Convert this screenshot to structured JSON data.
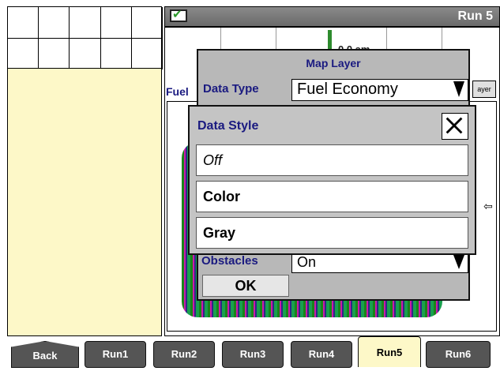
{
  "header": {
    "run_label": "Run 5"
  },
  "map": {
    "scale_label": "0.0 am",
    "field_label": "Fuel",
    "layer_button": "ayer"
  },
  "map_layer_dialog": {
    "title": "Map Layer",
    "data_type_label": "Data Type",
    "data_type_value": "Fuel Economy",
    "obstacles_label": "Obstacles",
    "obstacles_value": "On",
    "ok_label": "OK"
  },
  "data_style_popup": {
    "title": "Data Style",
    "options": [
      "Off",
      "Color",
      "Gray"
    ]
  },
  "tabs": [
    "Back",
    "Run1",
    "Run2",
    "Run3",
    "Run4",
    "Run5",
    "Run6"
  ],
  "active_tab": "Run5",
  "icons": {
    "status": "check-icon",
    "close": "close-icon",
    "dropdown": "dropdown-arrow-icon",
    "scroll": "left-arrow-icon"
  },
  "colors": {
    "panel": "#fdf8c8",
    "dialog": "#b8b8b8",
    "label_blue": "#1a1a80",
    "tab_dark": "#555555"
  }
}
